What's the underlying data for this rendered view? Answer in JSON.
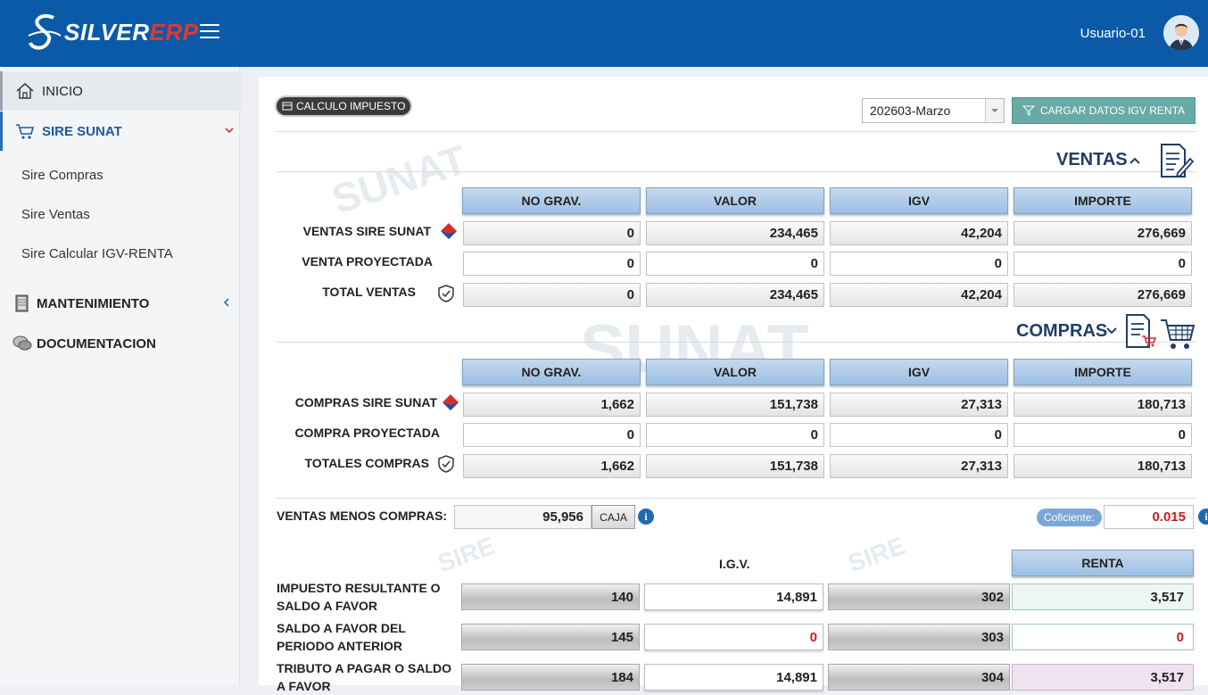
{
  "app": {
    "logo_text_white": "SILVER",
    "logo_text_red": "ERP",
    "user_name": "Usuario-01"
  },
  "sidebar": {
    "items": [
      {
        "label": "INICIO",
        "icon": "home-icon"
      },
      {
        "label": "SIRE SUNAT",
        "icon": "cart-icon"
      },
      {
        "label": "MANTENIMIENTO",
        "icon": "book-icon"
      },
      {
        "label": "DOCUMENTACION",
        "icon": "chat-icon"
      }
    ],
    "sub_items": [
      "Sire Compras",
      "Sire Ventas",
      "Sire Calcular IGV-RENTA"
    ]
  },
  "toolbar": {
    "badge_label": "CALCULO IMPUESTO",
    "period_value": "202603-Marzo",
    "load_button_label": "CARGAR DATOS IGV RENTA"
  },
  "ventas": {
    "title": "VENTAS",
    "headers": [
      "NO GRAV.",
      "VALOR",
      "IGV",
      "IMPORTE"
    ],
    "rows": [
      {
        "label": "VENTAS SIRE SUNAT",
        "values": [
          "0",
          "234,465",
          "42,204",
          "276,669"
        ]
      },
      {
        "label": "VENTA PROYECTADA",
        "values": [
          "0",
          "0",
          "0",
          "0"
        ]
      },
      {
        "label": "TOTAL VENTAS",
        "values": [
          "0",
          "234,465",
          "42,204",
          "276,669"
        ]
      }
    ]
  },
  "compras": {
    "title": "COMPRAS",
    "headers": [
      "NO GRAV.",
      "VALOR",
      "IGV",
      "IMPORTE"
    ],
    "rows": [
      {
        "label": "COMPRAS SIRE SUNAT",
        "values": [
          "1,662",
          "151,738",
          "27,313",
          "180,713"
        ]
      },
      {
        "label": "COMPRA PROYECTADA",
        "values": [
          "0",
          "0",
          "0",
          "0"
        ]
      },
      {
        "label": "TOTALES COMPRAS",
        "values": [
          "1,662",
          "151,738",
          "27,313",
          "180,713"
        ]
      }
    ]
  },
  "resumen": {
    "diff_label": "VENTAS MENOS COMPRAS:",
    "diff_value": "95,956",
    "caja_label": "CAJA",
    "coef_label": "Coficiente:",
    "coef_value": "0.015",
    "igv_header": "I.G.V.",
    "renta_header": "RENTA",
    "rows": [
      {
        "label": "IMPUESTO RESULTANTE O SALDO A FAVOR",
        "code_igv": "140",
        "igv": "14,891",
        "code_renta": "302",
        "renta": "3,517"
      },
      {
        "label": "SALDO A FAVOR DEL PERIODO ANTERIOR",
        "code_igv": "145",
        "igv": "0",
        "code_renta": "303",
        "renta": "0"
      },
      {
        "label": "TRIBUTO A PAGAR O SALDO A FAVOR",
        "code_igv": "184",
        "igv": "14,891",
        "code_renta": "304",
        "renta": "3,517"
      }
    ]
  },
  "watermark": {
    "text": "SUNAT",
    "text2": "SIRE"
  },
  "colors": {
    "topbar": "#0b5aa8",
    "accent_red": "#d11a1a",
    "header_blue": "#9cbfe3"
  }
}
